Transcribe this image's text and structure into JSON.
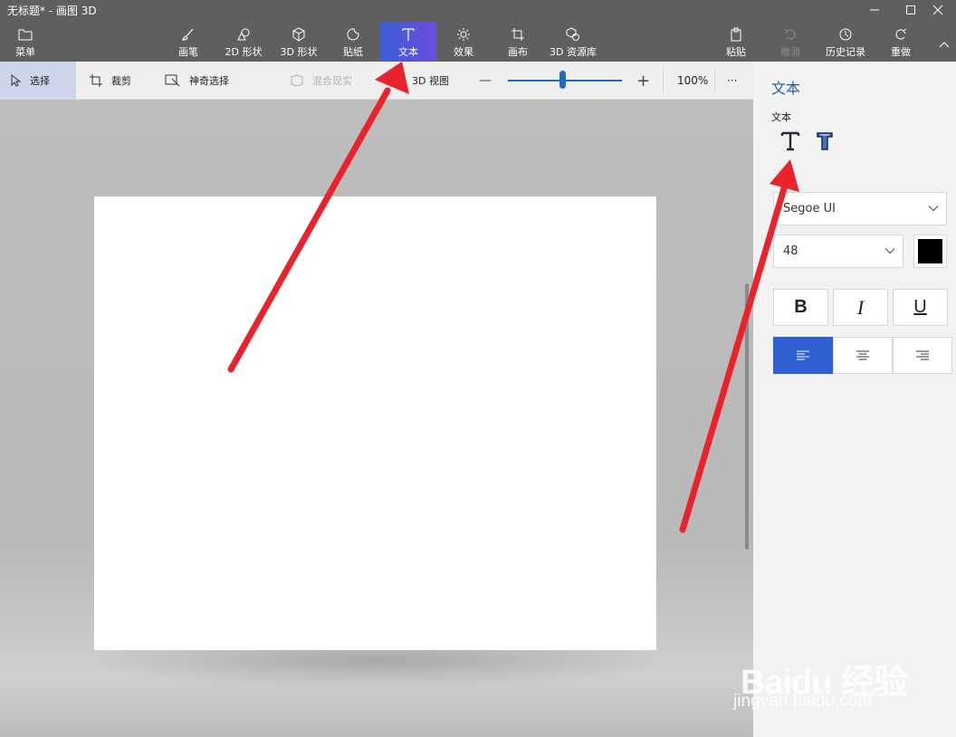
{
  "window": {
    "title": "无标题* - 画图 3D",
    "minimize_icon": "minimize-icon",
    "maximize_icon": "maximize-icon",
    "close_icon": "close-icon"
  },
  "ribbon": {
    "menu": "菜单",
    "brushes": "画笔",
    "shapes_2d": "2D 形状",
    "shapes_3d": "3D 形状",
    "stickers": "贴纸",
    "text": "文本",
    "effects": "效果",
    "canvas": "画布",
    "library_3d": "3D 资源库",
    "paste": "粘贴",
    "undo": "撤消",
    "history": "历史记录",
    "redo": "重做"
  },
  "toolbar": {
    "select": "选择",
    "crop": "裁剪",
    "magic_select": "神奇选择",
    "mixed_reality": "混合现实",
    "view_3d": "3D 视图",
    "zoom_minus": "—",
    "zoom_plus": "+",
    "zoom_level": "100%",
    "zoom_fraction": 0.48,
    "more": "···"
  },
  "panel": {
    "title": "文本",
    "subtitle": "文本",
    "font": "Segoe UI",
    "size": "48",
    "text_color": "#000000",
    "bold": "B",
    "italic": "I",
    "underline": "U"
  },
  "watermark": {
    "logo": "Baidu 经验",
    "url": "jingyan.baidu.com"
  },
  "colors": {
    "accent": "#2f5fd0",
    "ribbon_bg": "#5f5f5f",
    "annotation_arrow": "#e8232b"
  }
}
